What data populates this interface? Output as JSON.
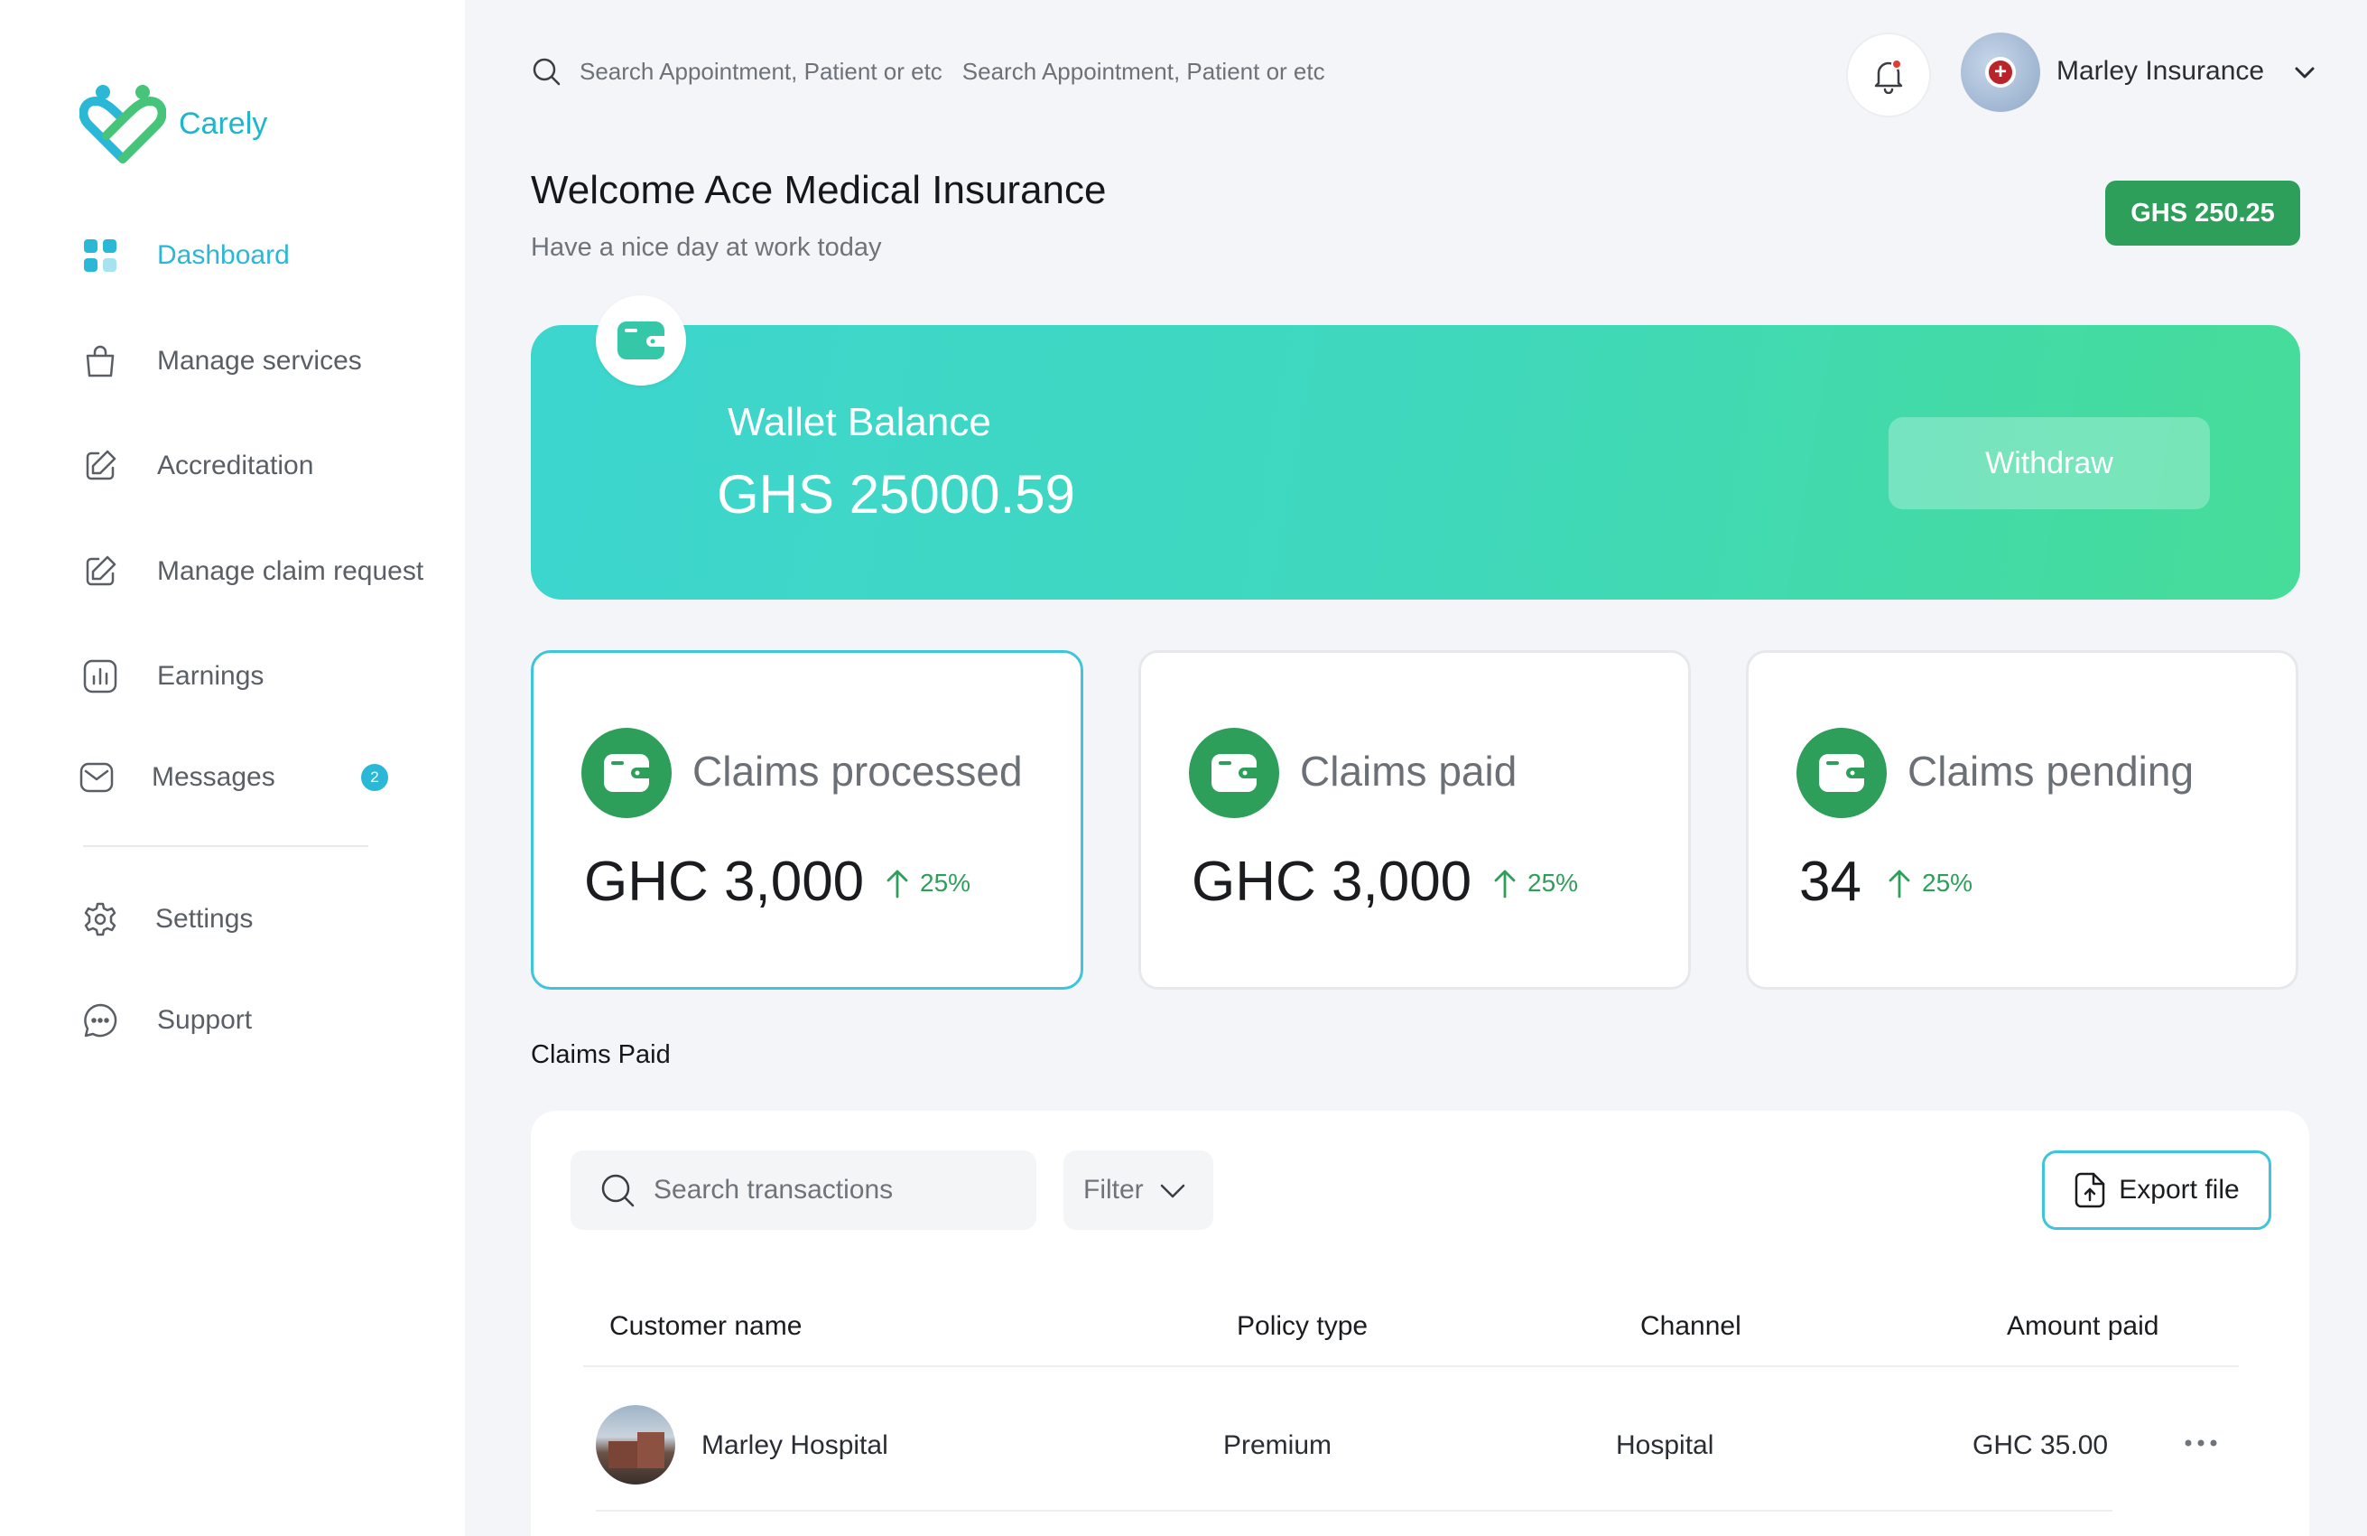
{
  "app": {
    "name": "Carely"
  },
  "sidebar": {
    "items": [
      {
        "label": "Dashboard"
      },
      {
        "label": "Manage services"
      },
      {
        "label": "Accreditation"
      },
      {
        "label": "Manage claim request"
      },
      {
        "label": "Earnings"
      },
      {
        "label": "Messages",
        "badge": "2"
      },
      {
        "label": "Settings"
      },
      {
        "label": "Support"
      }
    ]
  },
  "header": {
    "search_placeholder": "Search Appointment, Patient or etc",
    "search_placeholder_2": "Search Appointment, Patient or etc",
    "user_name": "Marley Insurance"
  },
  "welcome": {
    "title": "Welcome Ace Medical Insurance",
    "subtitle": "Have a nice day at work today",
    "balance_badge": "GHS 250.25"
  },
  "wallet": {
    "title": "Wallet Balance",
    "amount": "GHS 25000.59",
    "withdraw_label": "Withdraw"
  },
  "stats": [
    {
      "name": "Claims processed",
      "value": "GHC 3,000",
      "trend": "25%"
    },
    {
      "name": "Claims paid",
      "value": "GHC 3,000",
      "trend": "25%"
    },
    {
      "name": "Claims pending",
      "value": "34",
      "trend": "25%"
    }
  ],
  "claims_paid": {
    "title": "Claims Paid",
    "search_placeholder": "Search transactions",
    "filter_label": "Filter",
    "export_label": "Export file",
    "columns": [
      "Customer name",
      "Policy type",
      "Channel",
      "Amount paid"
    ],
    "rows": [
      {
        "customer": "Marley Hospital",
        "policy": "Premium",
        "channel": "Hospital",
        "amount": "GHC 35.00"
      }
    ]
  },
  "colors": {
    "accent": "#2bb8d6",
    "green": "#2e9f5a",
    "wallet_start": "#3dd6cf",
    "wallet_end": "#46dc99"
  },
  "icons": {
    "logo": "heart-logo-icon",
    "dashboard": "grid-icon",
    "manage_services": "bag-icon",
    "accreditation": "edit-icon",
    "manage_claim": "edit-icon",
    "earnings": "chart-icon",
    "messages": "mail-icon",
    "settings": "gear-icon",
    "support": "chat-icon",
    "search": "search-icon",
    "notification": "bell-icon",
    "wallet": "wallet-icon",
    "trend": "arrow-up-icon",
    "export": "file-upload-icon",
    "more": "more-horizontal-icon"
  }
}
